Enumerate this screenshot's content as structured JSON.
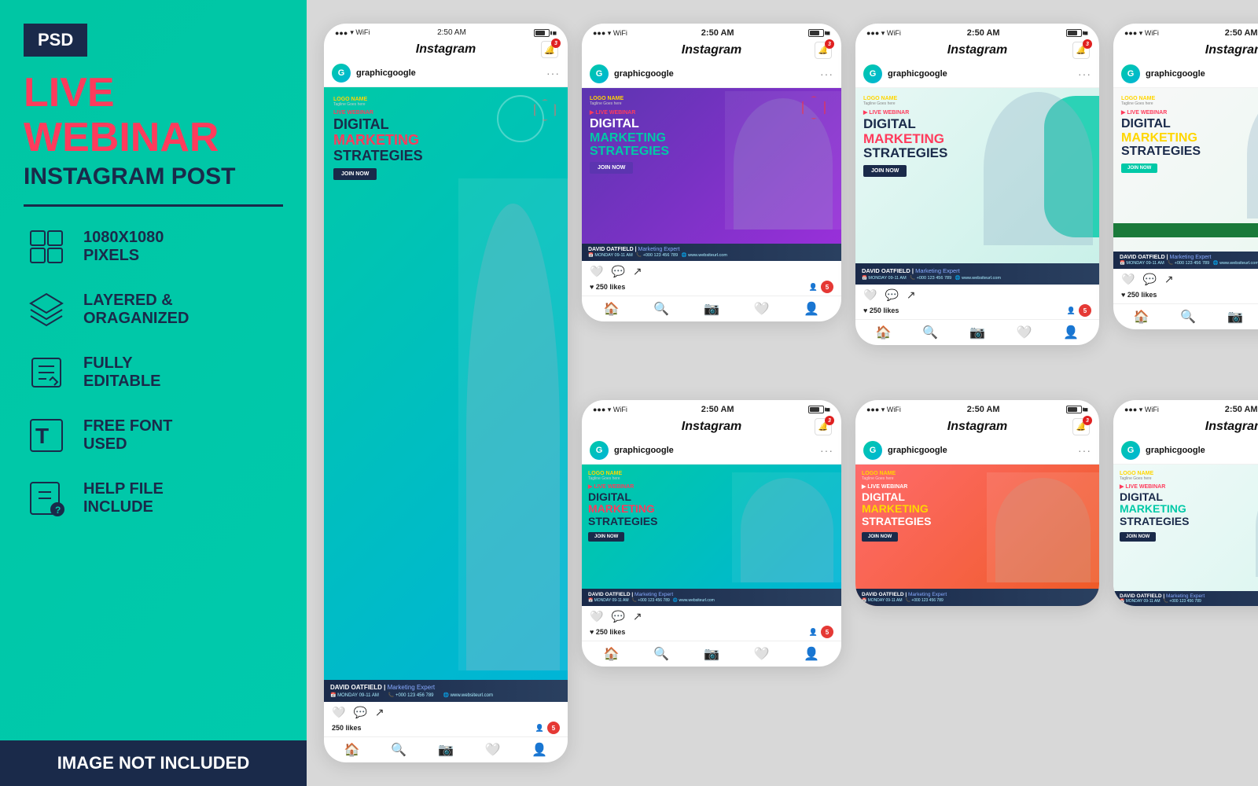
{
  "left": {
    "badge": "PSD",
    "title": "LIVE WEBINAR",
    "subtitle": "INSTAGRAM POST",
    "features": [
      {
        "id": "pixels",
        "text": "1080x1080\nPIXELS"
      },
      {
        "id": "layered",
        "text": "LAYERED &\nORAGANIZED"
      },
      {
        "id": "editable",
        "text": "FULLY\nEDITABLE"
      },
      {
        "id": "font",
        "text": "FREE FONT\nUSED"
      },
      {
        "id": "help",
        "text": "HELP FILE\nINCLUDE"
      }
    ],
    "image_not_included": "IMAGE NOT INCLUDED"
  },
  "instagram": {
    "app_name": "Instagram",
    "time": "2:50 AM",
    "username": "graphicgoogle",
    "notif_count": "3",
    "notif_count_5": "5",
    "likes": "250 likes",
    "post": {
      "logo_name": "LOGO NAME",
      "logo_sub": "Tagline Goes here",
      "live_label": "LIVE WEBINAR",
      "title_line1": "DIGITAL",
      "title_line2": "MARKETING",
      "title_line3": "STRATEGIES",
      "join_btn": "JOIN NOW",
      "speaker_name": "DAVID OATFIELD",
      "speaker_role": "Marketing Expert",
      "phone": "+000 123 456 789",
      "date": "MONDAY",
      "time_slot": "09-11 AM",
      "website": "www.websiteurl.com"
    }
  }
}
